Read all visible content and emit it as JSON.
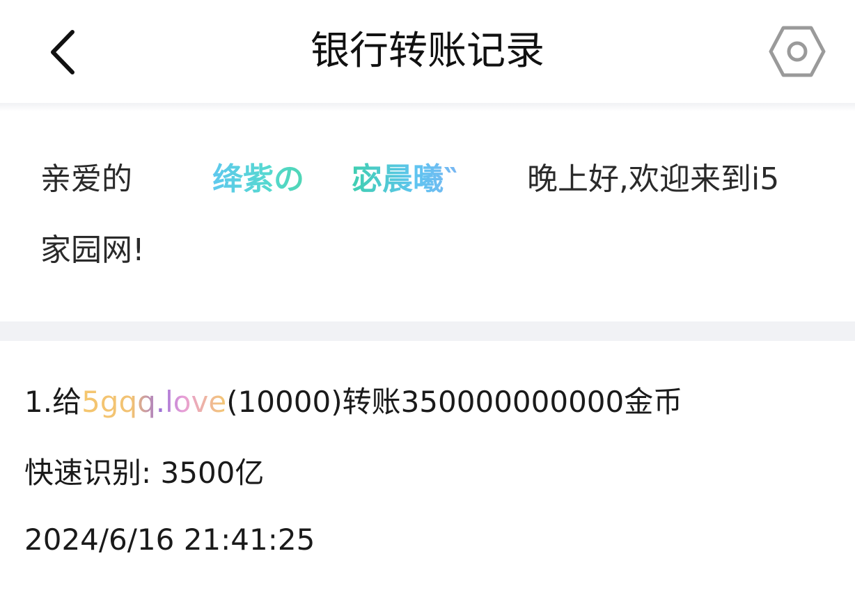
{
  "header": {
    "title": "银行转账记录",
    "back_icon": "chevron-left-icon",
    "settings_icon": "hexagon-settings-icon"
  },
  "greeting": {
    "prefix": "亲爱的",
    "name_part1": "绛紫の",
    "name_part2": "宓晨曦‶",
    "suffix": "晚上好,欢迎来到i5",
    "line2": "家园网!"
  },
  "record": {
    "index_label": "1.给",
    "receiver": "5gqq.love",
    "detail": "(10000)转账350000000000金币",
    "quick_label": "快速识别:",
    "quick_value": "3500亿",
    "timestamp": "2024/6/16 21:41:25"
  },
  "colors": {
    "name_gradient_start": "#5ec8ee",
    "name_gradient_end": "#4fd6b4",
    "receiver_gold": "#f5c66e",
    "receiver_purple": "#9b6fd6",
    "divider": "#f1f2f5"
  }
}
